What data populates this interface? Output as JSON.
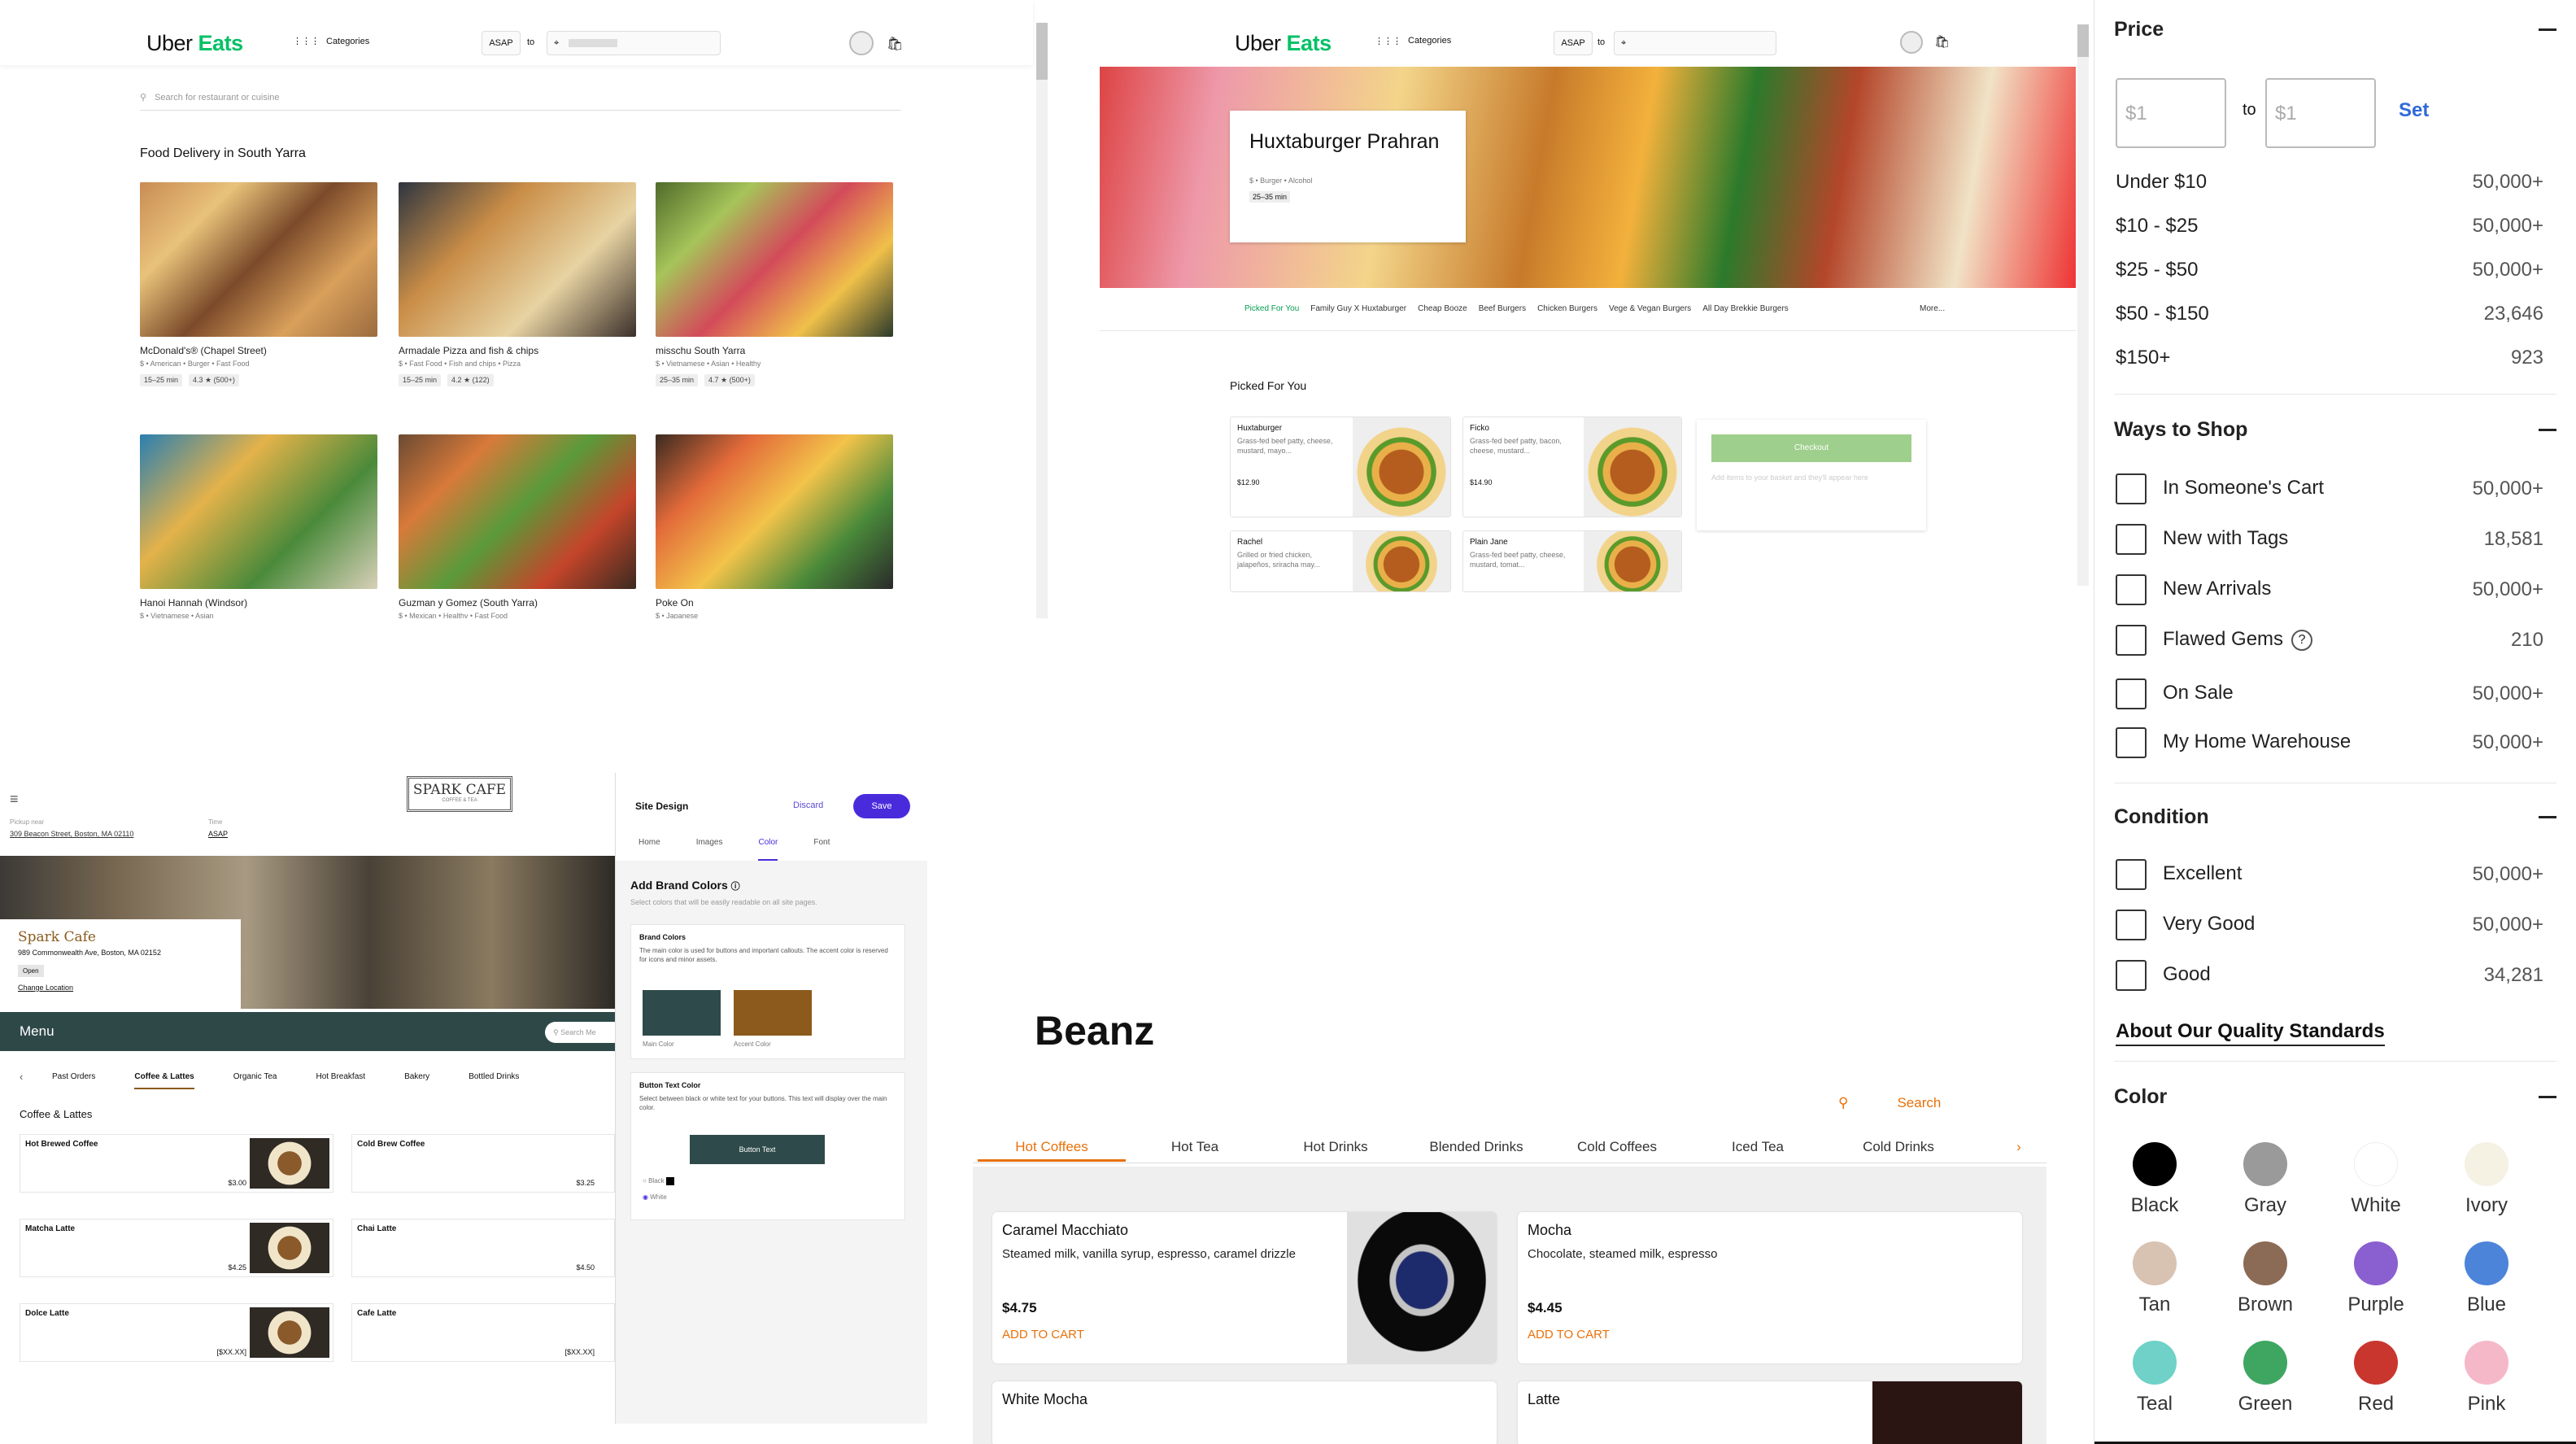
{
  "uber_list": {
    "logo_a": "Uber",
    "logo_b": "Eats",
    "categories": "Categories",
    "asap": "ASAP",
    "to": "to",
    "search_placeholder": "Search for restaurant or cuisine",
    "section_title": "Food Delivery in South Yarra",
    "restaurants": [
      {
        "name": "McDonald's® (Chapel Street)",
        "meta": "$ • American • Burger • Fast Food",
        "time": "15–25 min",
        "rating": "4.3 ★ (500+)"
      },
      {
        "name": "Armadale Pizza and fish & chips",
        "meta": "$ • Fast Food • Fish and chips • Pizza",
        "time": "15–25 min",
        "rating": "4.2 ★ (122)"
      },
      {
        "name": "misschu South Yarra",
        "meta": "$ • Vietnamese • Asian • Healthy",
        "time": "25–35 min",
        "rating": "4.7 ★ (500+)"
      },
      {
        "name": "Hanoi Hannah (Windsor)",
        "meta": "$ • Vietnamese • Asian",
        "time": "",
        "rating": ""
      },
      {
        "name": "Guzman y Gomez (South Yarra)",
        "meta": "$ • Mexican • Healthy • Fast Food",
        "time": "",
        "rating": ""
      },
      {
        "name": "Poke On",
        "meta": "$ • Japanese",
        "time": "",
        "rating": ""
      }
    ]
  },
  "huxta": {
    "logo_a": "Uber",
    "logo_b": "Eats",
    "categories": "Categories",
    "asap": "ASAP",
    "to": "to",
    "restaurant_name": "Huxtaburger Prahran",
    "restaurant_meta": "$ • Burger • Alcohol",
    "restaurant_time": "25–35 min",
    "menu_tabs": [
      "Picked For You",
      "Family Guy X Huxtaburger",
      "Cheap Booze",
      "Beef Burgers",
      "Chicken Burgers",
      "Vege & Vegan Burgers",
      "All Day Brekkie Burgers"
    ],
    "more": "More...",
    "section": "Picked For You",
    "items": [
      {
        "name": "Huxtaburger",
        "desc": "Grass-fed beef patty, cheese, mustard, mayo...",
        "price": "$12.90"
      },
      {
        "name": "Ficko",
        "desc": "Grass-fed beef patty, bacon, cheese, mustard...",
        "price": "$14.90"
      },
      {
        "name": "Rachel",
        "desc": "Grilled or fried chicken, jalapeños, sriracha may...",
        "price": ""
      },
      {
        "name": "Plain Jane",
        "desc": "Grass-fed beef patty, cheese, mustard, tomat...",
        "price": ""
      }
    ],
    "checkout": "Checkout",
    "cart_hint": "Add items to your basket and they'll appear here"
  },
  "filters": {
    "price": {
      "title": "Price",
      "min_placeholder": "$1",
      "max_placeholder": "$1",
      "to": "to",
      "set": "Set",
      "ranges": [
        {
          "label": "Under $10",
          "count": "50,000+"
        },
        {
          "label": "$10 - $25",
          "count": "50,000+"
        },
        {
          "label": "$25 - $50",
          "count": "50,000+"
        },
        {
          "label": "$50 - $150",
          "count": "23,646"
        },
        {
          "label": "$150+",
          "count": "923"
        }
      ]
    },
    "ways": {
      "title": "Ways to Shop",
      "items": [
        {
          "label": "In Someone's Cart",
          "count": "50,000+"
        },
        {
          "label": "New with Tags",
          "count": "18,581"
        },
        {
          "label": "New Arrivals",
          "count": "50,000+"
        },
        {
          "label": "Flawed Gems",
          "count": "210"
        },
        {
          "label": "On Sale",
          "count": "50,000+"
        },
        {
          "label": "My Home Warehouse",
          "count": "50,000+"
        }
      ]
    },
    "condition": {
      "title": "Condition",
      "items": [
        {
          "label": "Excellent",
          "count": "50,000+"
        },
        {
          "label": "Very Good",
          "count": "50,000+"
        },
        {
          "label": "Good",
          "count": "34,281"
        }
      ],
      "link": "About Our Quality Standards"
    },
    "color": {
      "title": "Color",
      "swatches": [
        {
          "label": "Black",
          "hex": "#000000"
        },
        {
          "label": "Gray",
          "hex": "#9a9a9a"
        },
        {
          "label": "White",
          "hex": "#ffffff"
        },
        {
          "label": "Ivory",
          "hex": "#f5f1e3"
        },
        {
          "label": "Tan",
          "hex": "#d8c2b2"
        },
        {
          "label": "Brown",
          "hex": "#8b6b55"
        },
        {
          "label": "Purple",
          "hex": "#8a5fcf"
        },
        {
          "label": "Blue",
          "hex": "#4c84d9"
        },
        {
          "label": "Teal",
          "hex": "#6fd1c8"
        },
        {
          "label": "Green",
          "hex": "#3fa661"
        },
        {
          "label": "Red",
          "hex": "#c8362d"
        },
        {
          "label": "Pink",
          "hex": "#f5b8c8"
        }
      ]
    }
  },
  "spark": {
    "logo": "SPARK CAFE",
    "logo_sub": "COFFEE & TEA",
    "pickup_label": "Pickup near",
    "pickup_addr": "309 Beacon Street, Boston, MA 02110",
    "time_label": "Time",
    "time_value": "ASAP",
    "cafe_name": "Spark Cafe",
    "cafe_addr": "989 Commonwealth Ave, Boston, MA 02152",
    "open": "Open",
    "change_location": "Change Location",
    "menu": "Menu",
    "search_placeholder": "Search Me",
    "tabs": [
      "Past Orders",
      "Coffee & Lattes",
      "Organic Tea",
      "Hot Breakfast",
      "Bakery",
      "Bottled Drinks"
    ],
    "section": "Coffee & Lattes",
    "items": [
      {
        "name": "Hot Brewed Coffee",
        "price": "$3.00"
      },
      {
        "name": "Cold Brew Coffee",
        "price": "$3.25"
      },
      {
        "name": "Matcha Latte",
        "price": "$4.25"
      },
      {
        "name": "Chai Latte",
        "price": "$4.50"
      },
      {
        "name": "Dolce Latte",
        "price": "[$XX.XX]"
      },
      {
        "name": "Cafe Latte",
        "price": "[$XX.XX]"
      }
    ],
    "design": {
      "title": "Site Design",
      "discard": "Discard",
      "save": "Save",
      "tabs": [
        "Home",
        "Images",
        "Color",
        "Font"
      ],
      "heading": "Add Brand Colors",
      "sub": "Select colors that will be easily readable on all site pages.",
      "brand_title": "Brand Colors",
      "brand_desc": "The main color is used for buttons and important callouts. The accent color is reserved for icons and minor assets.",
      "main_label": "Main Color",
      "accent_label": "Accent Color",
      "main_hex": "#2f4a4a",
      "accent_hex": "#8c5a1c",
      "btn_title": "Button Text Color",
      "btn_desc": "Select between black or white text for your buttons. This text will display over the main color.",
      "btn_sample": "Button Text",
      "opt_black": "Black",
      "opt_white": "White"
    }
  },
  "beanz": {
    "title": "Beanz",
    "search": "Search",
    "tabs": [
      "Hot Coffees",
      "Hot Tea",
      "Hot Drinks",
      "Blended Drinks",
      "Cold Coffees",
      "Iced Tea",
      "Cold Drinks"
    ],
    "add_label": "ADD TO CART",
    "cards": [
      {
        "name": "Caramel Macchiato",
        "desc": "Steamed milk, vanilla syrup, espresso, caramel drizzle",
        "price": "$4.75"
      },
      {
        "name": "Mocha",
        "desc": "Chocolate, steamed milk, espresso",
        "price": "$4.45"
      },
      {
        "name": "White Mocha",
        "desc": "",
        "price": ""
      },
      {
        "name": "Latte",
        "desc": "",
        "price": ""
      }
    ],
    "accent": "#e8710a"
  }
}
